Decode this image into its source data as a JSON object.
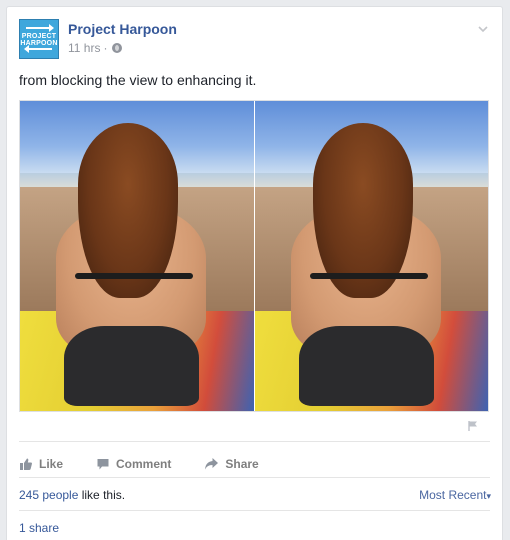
{
  "post": {
    "page_name": "Project Harpoon",
    "avatar_text": "PROJECT HARPOON",
    "timestamp": "11 hrs",
    "separator": "·",
    "privacy_icon": "globe-icon",
    "options_icon": "chevron-down-icon",
    "text": "from blocking the view to enhancing it.",
    "photo_description_icons": [
      "flag-icon"
    ]
  },
  "actions": {
    "like_label": "Like",
    "comment_label": "Comment",
    "share_label": "Share",
    "icons": [
      "thumbs-up-icon",
      "comment-icon",
      "share-icon"
    ]
  },
  "reactions": {
    "likes_count_text": "245 people",
    "likes_suffix": " like this.",
    "sort_label": "Most Recent",
    "sort_caret": "▾"
  },
  "shares": {
    "count_text": "1 share"
  },
  "colors": {
    "link_blue": "#365899",
    "meta_gray": "#90949c",
    "action_gray": "#7f7f7f",
    "brand_logo_blue": "#3fa7dc"
  }
}
